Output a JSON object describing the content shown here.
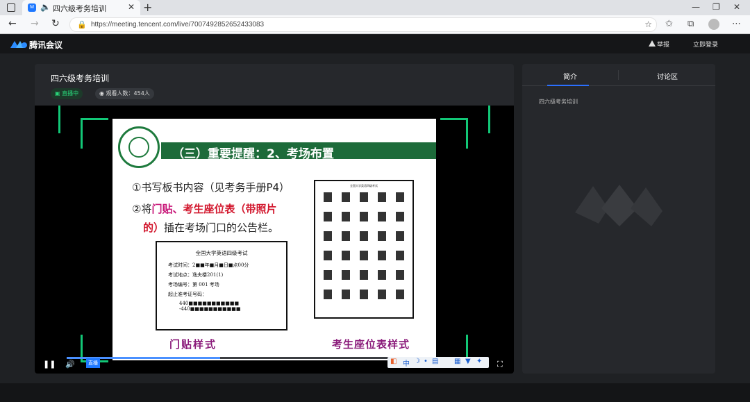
{
  "browser": {
    "tab_title": "四六级考务培训",
    "url": "https://meeting.tencent.com/live/7007492852652433083"
  },
  "app": {
    "brand": "腾讯会议",
    "report": "举报",
    "login": "立即登录"
  },
  "live": {
    "title": "四六级考务培训",
    "status": "直播中",
    "viewers": "观看人数：454人"
  },
  "slide": {
    "heading": "（三）重要提醒：2、考场布置",
    "line1": "①书写板书内容（见考务手册P4）",
    "line2_prefix": "②将",
    "line2_door": "门贴",
    "line2_sep": "、",
    "line2_seat": "考生座位表（带照片",
    "line3_a": "的）",
    "line3_b": "插在考场门口的公告栏。",
    "notice": {
      "title": "全国大学英语四级考试",
      "time": "考试时间：2■■年■月■日■点00分",
      "place": "考试地点：逸夫楼201(1)",
      "room": "考场编号：第 001 考场",
      "range": "起止准考证号码：",
      "range_value": "440■■■■■■■■■■■ -440■■■■■■■■■■■"
    },
    "seat_title": "全国大学英语四级考试",
    "caption_door": "门贴样式",
    "caption_seat": "考生座位表样式"
  },
  "player": {
    "live_label": "直播"
  },
  "sidebar": {
    "tab_intro": "简介",
    "tab_discuss": "讨论区",
    "intro_text": "四六级考务培训"
  },
  "colors": {
    "accent_green": "#12c777",
    "accent_blue": "#2b6fff",
    "slide_green": "#1d6b3a"
  }
}
